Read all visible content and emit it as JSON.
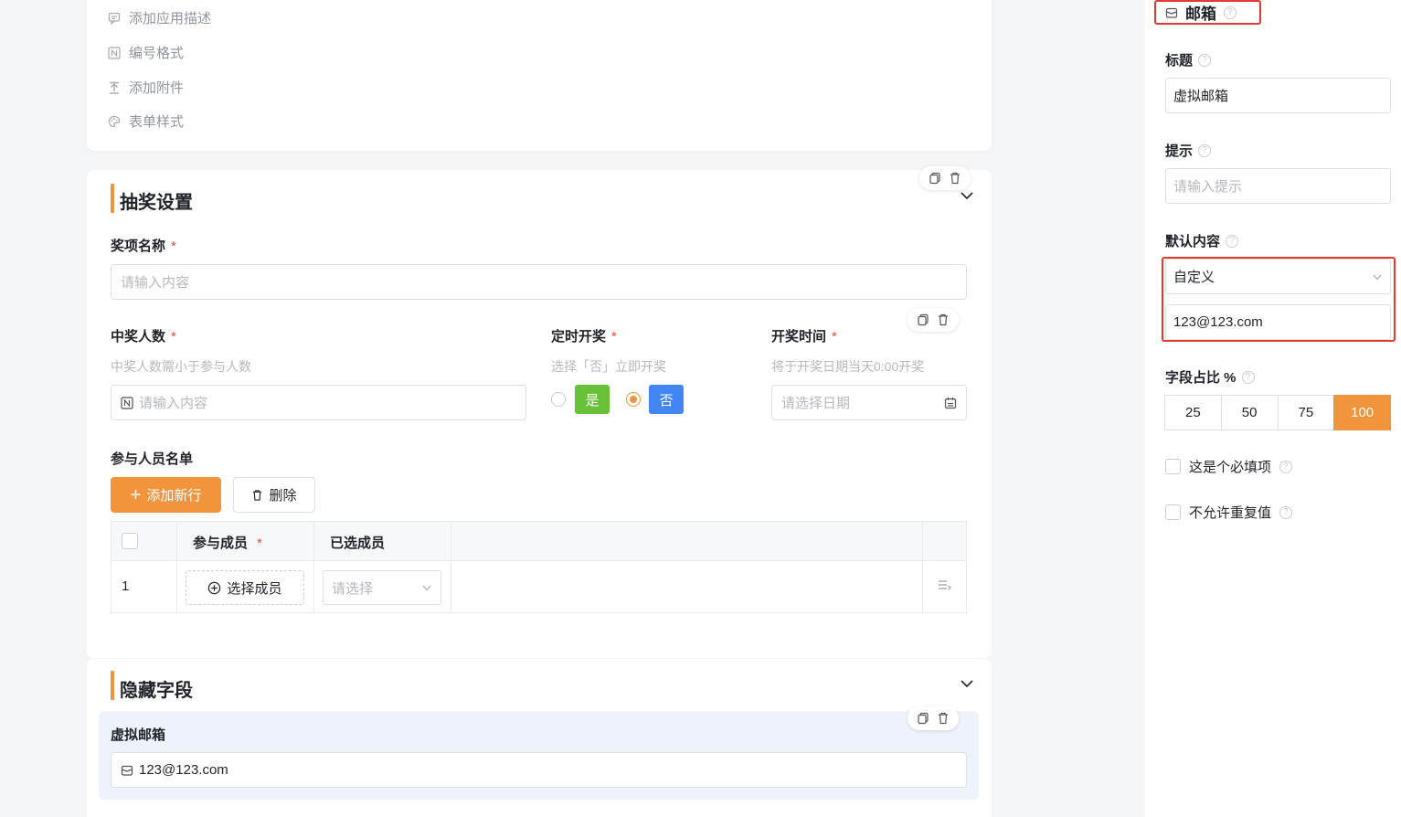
{
  "top_card": {
    "items": [
      {
        "label": "添加应用描述",
        "icon": "comment-icon"
      },
      {
        "label": "编号格式",
        "icon": "number-format-icon"
      },
      {
        "label": "添加附件",
        "icon": "upload-icon"
      },
      {
        "label": "表单样式",
        "icon": "palette-icon"
      }
    ]
  },
  "prize_section": {
    "title": "抽奖设置",
    "prize_name": {
      "label": "奖项名称",
      "required": "*",
      "placeholder": "请输入内容"
    },
    "winner_count": {
      "label": "中奖人数",
      "required": "*",
      "hint": "中奖人数需小于参与人数",
      "placeholder": "请输入内容"
    },
    "timed_draw": {
      "label": "定时开奖",
      "required": "*",
      "hint": "选择「否」立即开奖",
      "yes": "是",
      "no": "否",
      "selected": "否"
    },
    "draw_time": {
      "label": "开奖时间",
      "required": "*",
      "hint": "将于开奖日期当天0:00开奖",
      "placeholder": "请选择日期"
    },
    "participants": {
      "label": "参与人员名单",
      "add_button": "添加新行",
      "add_icon": "+",
      "delete_button": "删除",
      "columns": [
        "参与成员",
        "已选成员"
      ],
      "required": "*",
      "rows": [
        {
          "index": "1",
          "pick_label": "选择成员",
          "select_placeholder": "请选择"
        }
      ]
    }
  },
  "hidden_section": {
    "title": "隐藏字段",
    "field": {
      "label": "虚拟邮箱",
      "value": "123@123.com"
    }
  },
  "panel": {
    "title": "邮箱",
    "title_field": {
      "label": "标题",
      "value": "虚拟邮箱"
    },
    "hint_field": {
      "label": "提示",
      "placeholder": "请输入提示"
    },
    "default_field": {
      "label": "默认内容",
      "mode": "自定义",
      "value": "123@123.com"
    },
    "width_field": {
      "label": "字段占比 %",
      "options": [
        "25",
        "50",
        "75",
        "100"
      ],
      "selected": "100"
    },
    "required_check": {
      "label": "这是个必填项",
      "checked": false
    },
    "unique_check": {
      "label": "不允许重复值",
      "checked": false
    }
  },
  "colors": {
    "accent": "#f0953b",
    "yes_green": "#67c23a",
    "no_blue": "#4285f4",
    "highlight_red": "#e13b2f"
  }
}
